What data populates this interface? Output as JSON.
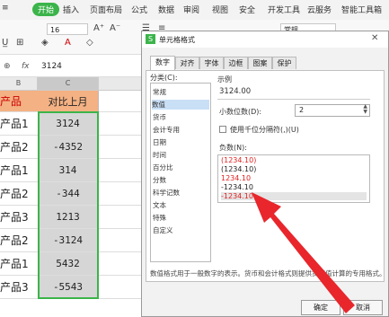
{
  "menu": {
    "tabs": [
      "开始",
      "插入",
      "页面布局",
      "公式",
      "数据",
      "审阅",
      "视图",
      "安全",
      "开发工具",
      "云服务",
      "智能工具箱"
    ]
  },
  "toolbar": {
    "font_size": "16",
    "number_format": "常规"
  },
  "formula_bar": {
    "cell_ref": "C3",
    "fx": "fx",
    "value": "3124"
  },
  "sheet": {
    "col_b": "B",
    "col_c": "C",
    "header_a": "产品",
    "header_c": "对比上月",
    "rows": [
      {
        "a": "产品1",
        "c": "3124"
      },
      {
        "a": "产品2",
        "c": "-4352"
      },
      {
        "a": "产品1",
        "c": "314"
      },
      {
        "a": "产品2",
        "c": "-344"
      },
      {
        "a": "产品3",
        "c": "1213"
      },
      {
        "a": "产品2",
        "c": "-3124"
      },
      {
        "a": "产品1",
        "c": "5432"
      },
      {
        "a": "产品3",
        "c": "-5543"
      }
    ]
  },
  "dialog": {
    "title": "单元格格式",
    "tabs": [
      "数字",
      "对齐",
      "字体",
      "边框",
      "图案",
      "保护"
    ],
    "category_label": "分类(C):",
    "categories": [
      "常规",
      "数值",
      "货币",
      "会计专用",
      "日期",
      "时间",
      "百分比",
      "分数",
      "科学记数",
      "文本",
      "特殊",
      "自定义"
    ],
    "selected_category": "数值",
    "sample_label": "示例",
    "sample_value": "3124.00",
    "decimals_label": "小数位数(D):",
    "decimals_value": "2",
    "thousands_label": "使用千位分隔符(,)(U)",
    "negative_label": "负数(N):",
    "negative_options": [
      {
        "text": "(1234.10)",
        "color": "#e02020"
      },
      {
        "text": "(1234.10)",
        "color": "#222222"
      },
      {
        "text": "1234.10",
        "color": "#e02020"
      },
      {
        "text": "-1234.10",
        "color": "#222222"
      },
      {
        "text": "-1234.10",
        "color": "#e02020"
      }
    ],
    "description": "数值格式用于一般数字的表示。货币和会计格式则提供货币值计算的专用格式。",
    "ok_label": "确定",
    "cancel_label": "取消"
  },
  "colors": {
    "accent": "#3bb44a",
    "header_fill": "#f4b183",
    "arrow": "#e8262c",
    "selection": "#c9dff6"
  }
}
